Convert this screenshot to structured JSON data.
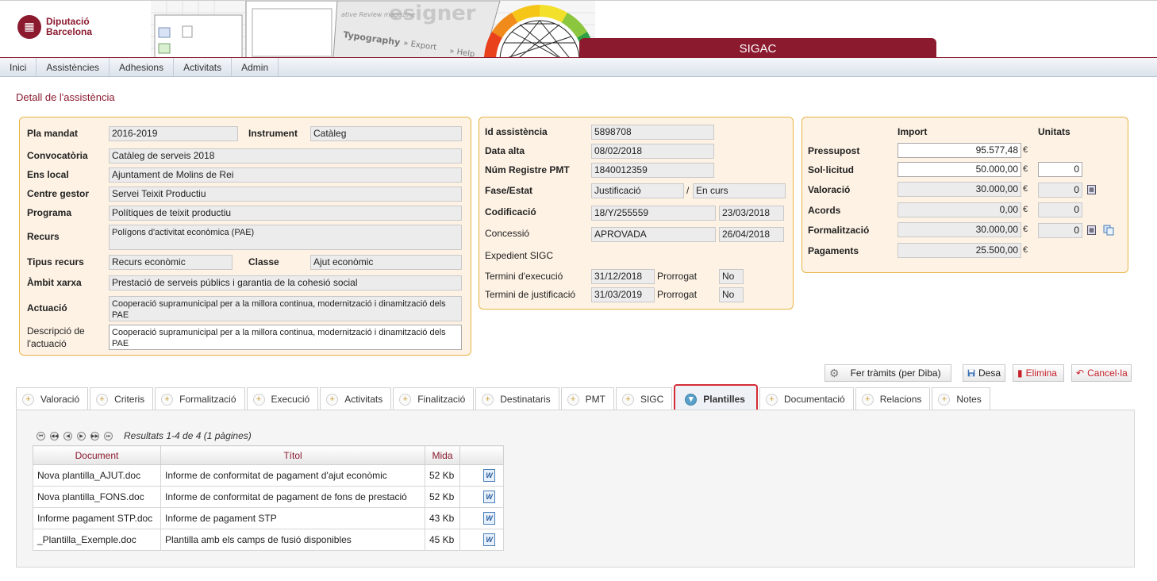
{
  "brand": {
    "line1": "Diputació",
    "line2": "Barcelona"
  },
  "header": {
    "app_title": "SIGAC",
    "deco_words": [
      "esigner",
      "ative Review magazine",
      "Typography",
      "» Export",
      "» Help"
    ]
  },
  "nav": [
    "Inici",
    "Assistències",
    "Adhesions",
    "Activitats",
    "Admin"
  ],
  "page_title": "Detall de l'assistència",
  "left_panel": {
    "pla_mandat_label": "Pla mandat",
    "pla_mandat": "2016-2019",
    "instrument_label": "Instrument",
    "instrument": "Catàleg",
    "convocatoria_label": "Convocatòria",
    "convocatoria": "Catàleg de serveis 2018",
    "ens_local_label": "Ens local",
    "ens_local": "Ajuntament de Molins de Rei",
    "centre_gestor_label": "Centre gestor",
    "centre_gestor": "Servei Teixit Productiu",
    "programa_label": "Programa",
    "programa": "Polítiques de teixit productiu",
    "recurs_label": "Recurs",
    "recurs": "Polígons d'activitat econòmica (PAE)",
    "tipus_recurs_label": "Tipus recurs",
    "tipus_recurs": "Recurs econòmic",
    "classe_label": "Classe",
    "classe": "Ajut econòmic",
    "ambit_label": "Àmbit xarxa",
    "ambit": "Prestació de serveis públics i garantia de la cohesió social",
    "actuacio_label": "Actuació",
    "actuacio": "Cooperació supramunicipal per a la millora continua, modernització i dinamització dels PAE",
    "descripcio_label_1": "Descripció de",
    "descripcio_label_2": "l'actuació",
    "descripcio": "Cooperació supramunicipal per a la millora continua, modernització i dinamització dels PAE"
  },
  "mid_panel": {
    "id_label": "Id assistència",
    "id": "5898708",
    "data_alta_label": "Data alta",
    "data_alta": "08/02/2018",
    "num_registre_label": "Núm Registre PMT",
    "num_registre": "1840012359",
    "fase_label": "Fase/Estat",
    "fase": "Justificació",
    "sep": "/",
    "estat": "En curs",
    "codificacio_label": "Codificació",
    "codificacio": "18/Y/255559",
    "codificacio_date": "23/03/2018",
    "concessio_label": "Concessió",
    "concessio": "APROVADA",
    "concessio_date": "26/04/2018",
    "expedient_label": "Expedient SIGC",
    "termini_exec_label": "Termini d'execució",
    "termini_exec": "31/12/2018",
    "prorrogat_label": "Prorrogat",
    "prorrogat_exec": "No",
    "termini_just_label": "Termini de justificació",
    "termini_just": "31/03/2019",
    "prorrogat_just": "No"
  },
  "right_panel": {
    "import_header": "Import",
    "unitats_header": "Unitats",
    "currency": "€",
    "rows": [
      {
        "label": "Pressupost",
        "import": "95.577,48",
        "unitats": null
      },
      {
        "label": "Sol·licitud",
        "import": "50.000,00",
        "unitats": "0"
      },
      {
        "label": "Valoració",
        "import": "30.000,00",
        "unitats": "0"
      },
      {
        "label": "Acords",
        "import": "0,00",
        "unitats": "0"
      },
      {
        "label": "Formalització",
        "import": "30.000,00",
        "unitats": "0"
      },
      {
        "label": "Pagaments",
        "import": "25.500,00",
        "unitats": null
      }
    ]
  },
  "actions": {
    "tramits": "Fer tràmits (per Diba)",
    "desa": "Desa",
    "elimina": "Elimina",
    "cancela": "Cancel·la"
  },
  "tabs": [
    "Valoració",
    "Criteris",
    "Formalització",
    "Execució",
    "Activitats",
    "Finalització",
    "Destinataris",
    "PMT",
    "SIGC",
    "Plantilles",
    "Documentació",
    "Relacions",
    "Notes"
  ],
  "results_text": "Resultats 1-4 de 4 (1 pàgines)",
  "table": {
    "headers": [
      "Document",
      "Títol",
      "Mida",
      ""
    ],
    "rows": [
      [
        "Nova plantilla_AJUT.doc",
        "Informe de conformitat de pagament d'ajut econòmic",
        "52 Kb"
      ],
      [
        "Nova plantilla_FONS.doc",
        "Informe de conformitat de pagament de fons de prestació",
        "52 Kb"
      ],
      [
        "Informe pagament STP.doc",
        "Informe de pagament STP",
        "43 Kb"
      ],
      [
        "_Plantilla_Exemple.doc",
        "Plantilla amb els camps de fusió disponibles",
        "45 Kb"
      ]
    ]
  },
  "colors": {
    "brand": "#8b1a2f",
    "panel_bg": "#fdf2e4",
    "panel_border": "#e8b447",
    "highlight": "#d42b36"
  },
  "icons": {
    "word": "W",
    "calculator": "▦",
    "copy": "⧉"
  }
}
